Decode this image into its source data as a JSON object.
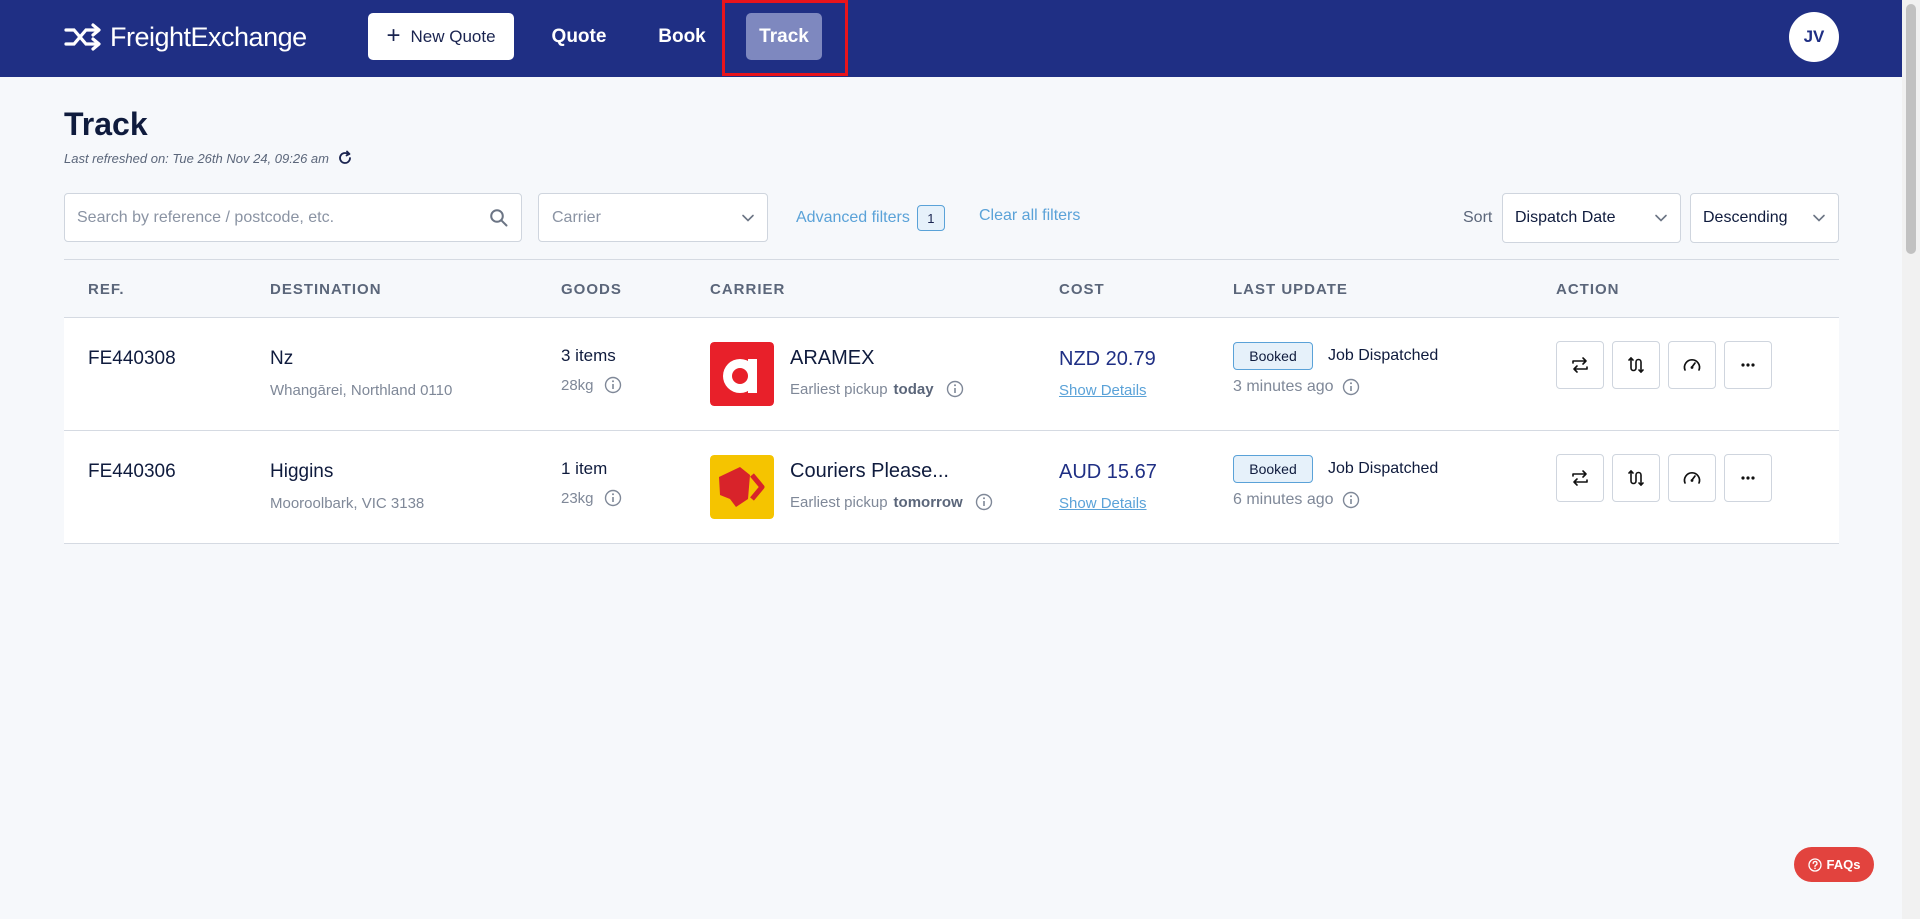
{
  "header": {
    "logo_text": "FreightExchange",
    "new_quote_label": "New Quote",
    "nav": {
      "quote": "Quote",
      "book": "Book",
      "track": "Track"
    },
    "avatar_initials": "JV"
  },
  "page": {
    "title": "Track",
    "last_refreshed": "Last refreshed on: Tue 26th Nov 24, 09:26 am"
  },
  "filters": {
    "search_placeholder": "Search by reference / postcode, etc.",
    "carrier_placeholder": "Carrier",
    "advanced_filters_label": "Advanced filters",
    "advanced_filters_count": "1",
    "clear_label": "Clear all filters",
    "sort_label": "Sort",
    "sort_by": "Dispatch Date",
    "sort_order": "Descending"
  },
  "table": {
    "headers": {
      "ref": "REF.",
      "destination": "DESTINATION",
      "goods": "GOODS",
      "carrier": "CARRIER",
      "cost": "COST",
      "last_update": "LAST UPDATE",
      "action": "ACTION"
    },
    "rows": [
      {
        "ref": "FE440308",
        "dest_name": "Nz",
        "dest_sub": "Whangārei, Northland 0110",
        "goods_count": "3 items",
        "goods_weight": "28kg",
        "carrier_name": "ARAMEX",
        "pickup_prefix": "Earliest pickup",
        "pickup_when": "today",
        "cost": "NZD 20.79",
        "show_details": "Show Details",
        "status_badge": "Booked",
        "status": "Job Dispatched",
        "updated": "3 minutes ago"
      },
      {
        "ref": "FE440306",
        "dest_name": "Higgins",
        "dest_sub": "Mooroolbark, VIC 3138",
        "goods_count": "1 item",
        "goods_weight": "23kg",
        "carrier_name": "Couriers Please...",
        "pickup_prefix": "Earliest pickup",
        "pickup_when": "tomorrow",
        "cost": "AUD 15.67",
        "show_details": "Show Details",
        "status_badge": "Booked",
        "status": "Job Dispatched",
        "updated": "6 minutes ago"
      }
    ]
  },
  "faq_label": "FAQs",
  "colors": {
    "header_bg": "#1f2f84",
    "active_tab": "#7e88bf",
    "accent_link": "#5aa2d8",
    "faq_button": "#e2433e",
    "aramex_red": "#e8202a",
    "couriers_please_yellow": "#f5c400"
  },
  "icons": [
    "shuffle-logo-icon",
    "plus-icon",
    "refresh-icon",
    "search-icon",
    "chevron-down-icon",
    "info-icon",
    "repeat-icon",
    "route-icon",
    "speedometer-icon",
    "more-icon",
    "question-icon"
  ]
}
